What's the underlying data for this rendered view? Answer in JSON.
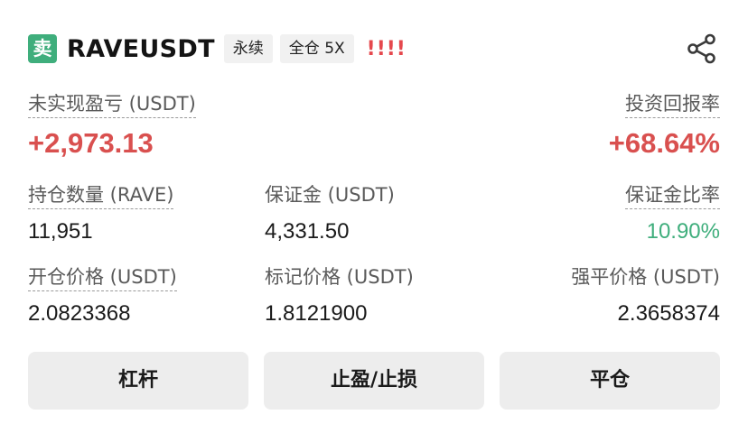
{
  "header": {
    "side_badge": "卖",
    "symbol": "RAVEUSDT",
    "tags": [
      "永续",
      "全仓 5X"
    ],
    "warning": "!!!!",
    "share_icon": "share-icon"
  },
  "pnl": {
    "label": "未实现盈亏 (USDT)",
    "value": "+2,973.13"
  },
  "roi": {
    "label": "投资回报率",
    "value": "+68.64%"
  },
  "position_size": {
    "label": "持仓数量 (RAVE)",
    "value": "11,951"
  },
  "margin": {
    "label": "保证金 (USDT)",
    "value": "4,331.50"
  },
  "margin_ratio": {
    "label": "保证金比率",
    "value": "10.90%"
  },
  "entry_price": {
    "label": "开仓价格 (USDT)",
    "value": "2.0823368"
  },
  "mark_price": {
    "label": "标记价格 (USDT)",
    "value": "1.8121900"
  },
  "liq_price": {
    "label": "强平价格 (USDT)",
    "value": "2.3658374"
  },
  "buttons": {
    "leverage": "杠杆",
    "tpsl": "止盈/止损",
    "close": "平仓"
  },
  "colors": {
    "sell_badge": "#3fae7c",
    "profit": "#d9504f",
    "ratio": "#3fae7c",
    "warning": "#e5484d"
  }
}
